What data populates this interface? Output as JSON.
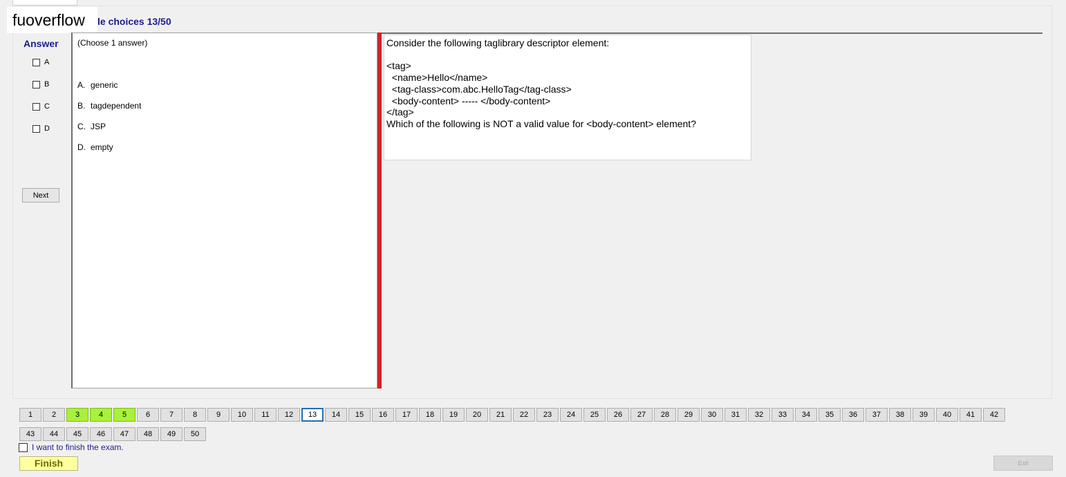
{
  "header": {
    "watermark": "fuoverflow",
    "section_title": "le choices 13/50"
  },
  "answer_panel": {
    "label": "Answer",
    "options": [
      "A",
      "B",
      "C",
      "D"
    ],
    "next_label": "Next"
  },
  "choices": {
    "hint": "(Choose 1 answer)",
    "items": [
      {
        "letter": "A.",
        "text": "generic"
      },
      {
        "letter": "B.",
        "text": "tagdependent"
      },
      {
        "letter": "C.",
        "text": "JSP"
      },
      {
        "letter": "D.",
        "text": "empty"
      }
    ]
  },
  "question": {
    "lines": [
      "Consider the following taglibrary descriptor element:",
      "",
      "<tag>",
      "  <name>Hello</name>",
      "  <tag-class>com.abc.HelloTag</tag-class>",
      "  <body-content> ----- </body-content>",
      "</tag>",
      "Which of the following is NOT a valid value for <body-content> element?"
    ]
  },
  "navigation": {
    "row1": [
      "1",
      "2",
      "3",
      "4",
      "5",
      "6",
      "7",
      "8",
      "9",
      "10",
      "11",
      "12",
      "13",
      "14",
      "15",
      "16",
      "17",
      "18",
      "19",
      "20",
      "21",
      "22",
      "23",
      "24",
      "25",
      "26",
      "27",
      "28",
      "29",
      "30",
      "31",
      "32",
      "33",
      "34",
      "35",
      "36",
      "37",
      "38",
      "39",
      "40",
      "41",
      "42"
    ],
    "row2": [
      "43",
      "44",
      "45",
      "46",
      "47",
      "48",
      "49",
      "50"
    ],
    "answered": [
      "3",
      "4",
      "5"
    ],
    "current": "13"
  },
  "footer": {
    "finish_checkbox_label": "I want to finish the exam.",
    "finish_label": "Finish",
    "exit_label": "Exit"
  },
  "colors": {
    "title_blue": "#1c1c8e",
    "divider_red": "#d0232b",
    "answered_green": "#a9f13a",
    "current_border": "#1f6fb5",
    "finish_yellow": "#ffff9e"
  }
}
